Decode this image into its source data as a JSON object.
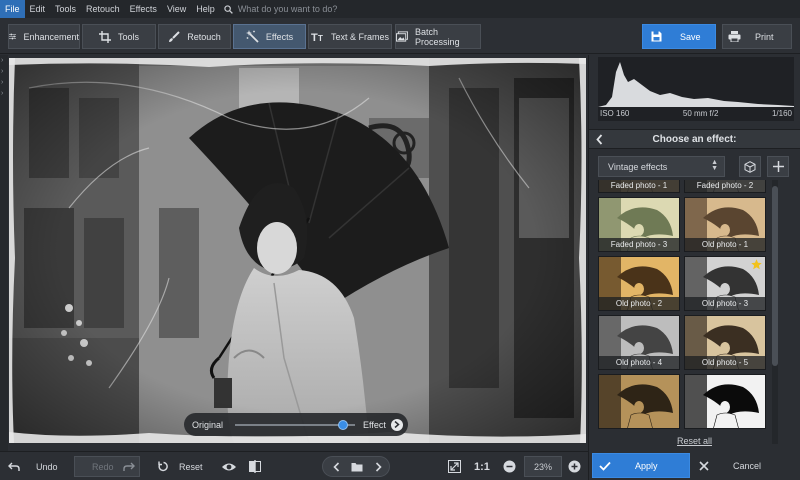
{
  "menu": {
    "items": [
      "File",
      "Edit",
      "Tools",
      "Retouch",
      "Effects",
      "View",
      "Help"
    ],
    "search_placeholder": "What do you want to do?"
  },
  "toolbar": {
    "tabs": [
      "Enhancement",
      "Tools",
      "Retouch",
      "Effects",
      "Text & Frames",
      "Batch Processing"
    ],
    "active_tab": "Effects",
    "save_label": "Save",
    "print_label": "Print"
  },
  "compare": {
    "original_label": "Original",
    "effect_label": "Effect",
    "slider_value_percent": 90
  },
  "bottom": {
    "undo_label": "Undo",
    "redo_label": "Redo",
    "reset_label": "Reset",
    "ratio_label": "1:1",
    "zoom_value": "23%"
  },
  "histogram": {
    "iso": "ISO 160",
    "lens": "50 mm f/2",
    "shutter": "1/160"
  },
  "effects_panel": {
    "title": "Choose an effect:",
    "category": "Vintage effects",
    "reset_all": "Reset all",
    "apply_label": "Apply",
    "cancel_label": "Cancel",
    "thumbnails": [
      {
        "label": "Faded photo - 1",
        "favorite": false
      },
      {
        "label": "Faded photo - 2",
        "favorite": false
      },
      {
        "label": "Faded photo - 3",
        "favorite": false
      },
      {
        "label": "Old photo - 1",
        "favorite": false
      },
      {
        "label": "Old photo - 2",
        "favorite": false
      },
      {
        "label": "Old photo - 3",
        "favorite": true
      },
      {
        "label": "Old photo - 4",
        "favorite": false
      },
      {
        "label": "Old photo - 5",
        "favorite": false
      },
      {
        "label": "",
        "favorite": false
      },
      {
        "label": "",
        "favorite": false
      }
    ]
  },
  "colors": {
    "accent": "#2f7dd6",
    "star": "#f2c21b"
  }
}
